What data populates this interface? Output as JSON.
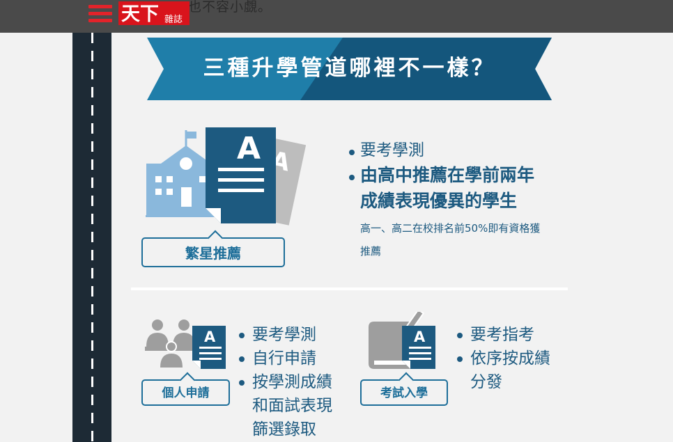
{
  "header": {
    "behind_text": "也不容小覷。",
    "logo_main": "天下",
    "logo_sub": "雜誌",
    "menu_icon": "hamburger-menu-icon"
  },
  "banner": {
    "title": "三種升學管道哪裡不一樣？"
  },
  "section_star": {
    "label": "繁星推薦",
    "bullet_1": "要考學測",
    "bullet_2_line1": "由高中推薦在學前兩年",
    "bullet_2_line2": "成績表現優異的學生",
    "note_line1": "高一、高二在校排名前50%即有資格獲",
    "note_line2": "推薦",
    "doc_letter": "A"
  },
  "section_personal": {
    "label": "個人申請",
    "bullets": [
      "要考學測",
      "自行申請",
      "按學測成績",
      "和面試表現",
      "篩選錄取"
    ],
    "doc_letter": "A"
  },
  "section_exam": {
    "label": "考試入學",
    "bullets": [
      "要考指考",
      "依序按成績",
      "分發"
    ],
    "doc_letter": "A"
  },
  "colors": {
    "accent_blue": "#1d6e99",
    "dark_navy": "#1d2a35",
    "brand_red": "#d9141c",
    "light_blue": "#8ab8dc"
  }
}
